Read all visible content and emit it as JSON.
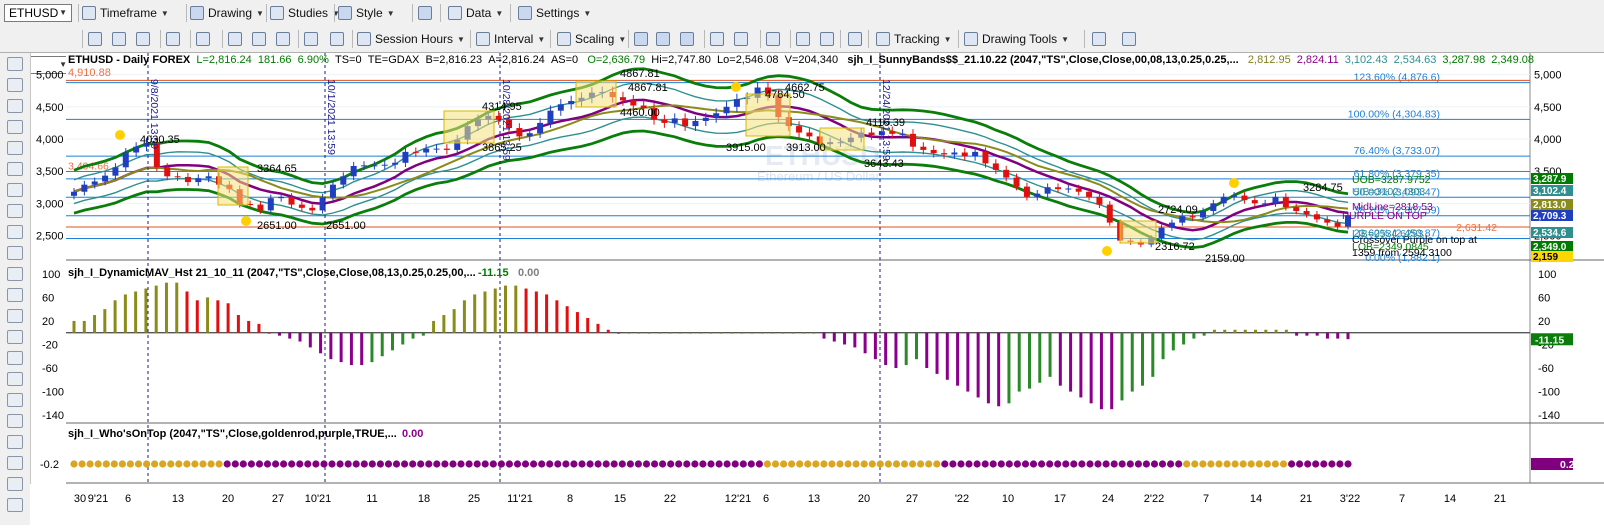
{
  "toolbar": {
    "symbol": "ETHUSD",
    "row1": [
      {
        "name": "timeframe-menu",
        "icon": "clock-icon",
        "label": "Timeframe"
      },
      {
        "name": "drawing-menu",
        "icon": "pencil-icon",
        "label": "Drawing"
      },
      {
        "name": "studies-menu",
        "icon": "studies-icon",
        "label": "Studies"
      },
      {
        "name": "style-menu",
        "icon": "style-icon",
        "label": "Style"
      },
      {
        "name": "data-menu",
        "icon": "data-icon",
        "label": "Data"
      },
      {
        "name": "settings-menu",
        "icon": "gear-icon",
        "label": "Settings"
      }
    ],
    "row2": [
      {
        "name": "session-hours-menu",
        "icon": "session-icon",
        "label": "Session Hours"
      },
      {
        "name": "interval-menu",
        "icon": "interval-icon",
        "label": "Interval"
      },
      {
        "name": "scaling-menu",
        "icon": "scaling-icon",
        "label": "Scaling"
      },
      {
        "name": "tracking-menu",
        "icon": "tracking-icon",
        "label": "Tracking"
      },
      {
        "name": "drawing-tools-menu",
        "icon": "drawing-tools-icon",
        "label": "Drawing Tools"
      }
    ]
  },
  "header": {
    "symbol_line": "ETHUSD - Daily  FOREX",
    "L": "L=2,816.24",
    "chg": "181.66",
    "pct": "6.90%",
    "ts": "TS=0",
    "te": "TE=GDAX",
    "B": "B=2,816.23",
    "A": "A=2,816.24",
    "AS": "AS=0",
    "O": "O=2,636.79",
    "Hi": "Hi=2,747.80",
    "Lo": "Lo=2,546.08",
    "V": "V=204,340",
    "study": "sjh_I_SunnyBands$$_21.10.22 (2047,\"TS\",Close,Close,00,08,13,0.25,0.25,...",
    "vals": [
      {
        "v": "2,812.95",
        "c": "#7f7f1f"
      },
      {
        "v": "2,824.11",
        "c": "#8b008b"
      },
      {
        "v": "3,102.43",
        "c": "#2f8f8f"
      },
      {
        "v": "2,534.63",
        "c": "#2f8f8f"
      },
      {
        "v": "3,287.98",
        "c": "#007a00"
      },
      {
        "v": "2,349.08",
        "c": "#007a00"
      }
    ],
    "top_left_orange": "4,910.88"
  },
  "watermark": {
    "title": "ETHUSD",
    "subtitle": "Ethereum / US Dollar"
  },
  "chart_data": [
    {
      "type": "candlestick",
      "title": "ETHUSD - Daily  FOREX",
      "ylim": [
        2150,
        5150
      ],
      "yticks": [
        2500,
        3000,
        3500,
        4000,
        4500,
        5000
      ],
      "ytick_labels": [
        "2,500",
        "3,000",
        "3,500",
        "4,000",
        "4,500",
        "5,000"
      ],
      "x_labels": [
        "30",
        "9'21",
        "6",
        "13",
        "20",
        "27",
        "10'21",
        "11",
        "18",
        "25",
        "11'21",
        "8",
        "15",
        "22",
        "12'21",
        "6",
        "13",
        "20",
        "27",
        "'22",
        "10",
        "17",
        "24",
        "2'22",
        "7",
        "14",
        "21",
        "3'22",
        "7",
        "14",
        "21"
      ],
      "close": [
        3180,
        3290,
        3340,
        3430,
        3560,
        3790,
        3880,
        3940,
        3560,
        3420,
        3410,
        3330,
        3390,
        3420,
        3290,
        3220,
        2990,
        2980,
        2890,
        3080,
        3100,
        2980,
        2930,
        2890,
        3090,
        3290,
        3420,
        3580,
        3590,
        3590,
        3600,
        3630,
        3800,
        3790,
        3850,
        3850,
        3830,
        3990,
        4200,
        4300,
        4360,
        4300,
        4170,
        4040,
        4090,
        4250,
        4440,
        4540,
        4590,
        4640,
        4720,
        4730,
        4650,
        4600,
        4520,
        4480,
        4300,
        4250,
        4320,
        4200,
        4280,
        4330,
        4400,
        4500,
        4620,
        4640,
        4800,
        4680,
        4340,
        4200,
        4100,
        4040,
        3920,
        3950,
        3950,
        4020,
        4100,
        4060,
        4120,
        4080,
        4080,
        3880,
        3830,
        3780,
        3760,
        3790,
        3730,
        3800,
        3620,
        3520,
        3400,
        3260,
        3100,
        3150,
        3250,
        3220,
        3230,
        3180,
        3100,
        2980,
        2700,
        2420,
        2400,
        2360,
        2460,
        2620,
        2700,
        2800,
        2780,
        2880,
        3000,
        3100,
        3120,
        3050,
        3000,
        3000,
        3100,
        2940,
        2880,
        2830,
        2750,
        2700,
        2640,
        2816
      ],
      "horizontal_levels": [
        {
          "label": "123.60% (4,876.6)",
          "value": 4876.6,
          "color": "#1e7fd6"
        },
        {
          "label": "100.00% (4,304.83)",
          "value": 4304.83,
          "color": "#1e7fd6"
        },
        {
          "label": "76.40% (3,733.07)",
          "value": 3733.07,
          "color": "#1e7fd6"
        },
        {
          "label": "61.80% (3,379.35)",
          "value": 3379.35,
          "color": "#1e7fd6"
        },
        {
          "label": "50.00% (3,093.47)",
          "value": 3093.47,
          "color": "#1e7fd6"
        },
        {
          "label": "38.20% (2,807.59)",
          "value": 2807.59,
          "color": "#1e7fd6"
        },
        {
          "label": "23.60% (2,453.87)",
          "value": 2453.87,
          "color": "#1e7fd6"
        },
        {
          "label": "0.00% (1,882.1)",
          "value": 1882.1,
          "color": "#1e7fd6"
        }
      ],
      "orange_levels": [
        {
          "label": "4,910.88",
          "value": 4910.88
        },
        {
          "label": "3,494.66",
          "value": 3494.66
        },
        {
          "label": "2,631.42",
          "value": 2631.42
        }
      ],
      "annotations": [
        "4867.81",
        "4867.81",
        "4784.50",
        "4662.75",
        "4460.00",
        "4314.95",
        "4030.35",
        "3915.00",
        "3913.00",
        "4116.39",
        "3865.25",
        "3643.43",
        "3364.65",
        "3284.75",
        "2724.09",
        "2651.00",
        "2651.00",
        "2316.72",
        "2159.00",
        "PURPLE ON TOP",
        "Crossover Purple on top at",
        "1359 from 2594.3100"
      ],
      "band_labels": [
        {
          "label": "UOB=3287.9752",
          "color": "#007a00"
        },
        {
          "label": "UIB=3102.4303",
          "color": "#2f8f8f"
        },
        {
          "label": "MidLine=2818.53",
          "color": "#8b008b"
        },
        {
          "label": "LIB=2534.6293",
          "color": "#2f8f8f"
        },
        {
          "label": "LOB=2349.0845",
          "color": "#007a00"
        }
      ],
      "price_tags": [
        {
          "v": "3,287.9",
          "bg": "#007a00",
          "fg": "#ffffff"
        },
        {
          "v": "3,102.4",
          "bg": "#2f8f8f",
          "fg": "#ffffff"
        },
        {
          "v": "2,813.0",
          "bg": "#8b8b1a",
          "fg": "#ffffff"
        },
        {
          "v": "2,709.3",
          "bg": "#1f3fbf",
          "fg": "#ffffff"
        },
        {
          "v": "2,534.6",
          "bg": "#2f8f8f",
          "fg": "#ffffff"
        },
        {
          "v": "2,349.0",
          "bg": "#007a00",
          "fg": "#ffffff"
        },
        {
          "v": "2,159",
          "bg": "#ffd700",
          "fg": "#000000"
        }
      ],
      "vertical_date_labels": [
        "9/8/2021 13:59",
        "10/1/2021 13:59",
        "10/28/2021 13:59",
        "12/24/2021 13:59"
      ]
    },
    {
      "type": "bar",
      "title": "sjh_I_DynamicMAV_Hst 21_10_11 (2047,\"TS\",Close,Close,08,13,0.25,0.25,00,...",
      "value_label": "-11.15",
      "value_label2": "0.00",
      "ylim": [
        -150,
        115
      ],
      "yticks": [
        100,
        60,
        20,
        -20,
        -60,
        -100,
        -140
      ],
      "ytick_labels": [
        "100",
        "60",
        "20",
        "-20",
        "-60",
        "-100",
        "-140"
      ],
      "values": [
        20,
        20,
        30,
        40,
        55,
        65,
        70,
        75,
        80,
        85,
        85,
        70,
        55,
        60,
        55,
        50,
        30,
        20,
        15,
        0,
        -5,
        -10,
        -15,
        -25,
        -35,
        -45,
        -50,
        -55,
        -55,
        -50,
        -40,
        -30,
        -20,
        -10,
        -5,
        20,
        30,
        40,
        55,
        65,
        70,
        75,
        80,
        80,
        75,
        70,
        65,
        55,
        45,
        35,
        25,
        15,
        5,
        0,
        0,
        0,
        0,
        0,
        0,
        0,
        0,
        0,
        0,
        0,
        0,
        0,
        0,
        0,
        0,
        0,
        0,
        0,
        0,
        -10,
        -15,
        -20,
        -25,
        -35,
        -45,
        -55,
        -60,
        -55,
        -45,
        -60,
        -70,
        -80,
        -90,
        -100,
        -110,
        -120,
        -125,
        -120,
        -100,
        -95,
        -85,
        -75,
        -90,
        -100,
        -110,
        -120,
        -130,
        -130,
        -115,
        -100,
        -90,
        -75,
        -45,
        -30,
        -20,
        -10,
        -5,
        5,
        5,
        5,
        5,
        5,
        5,
        5,
        5,
        -5,
        -5,
        -5,
        -10,
        -10,
        -11
      ],
      "colors_rule": "positive: olive rising / red falling; negative: purple falling / green rising",
      "last_value_tag": "-11.15"
    },
    {
      "type": "dots",
      "title": "sjh_I_Who'sOnTop (2047,\"TS\",Close,goldenrod,purple,TRUE,...",
      "value_label": "0.00",
      "ylim": [
        -0.35,
        0.1
      ],
      "yticks": [
        -0.2
      ],
      "ytick_labels": [
        "-0.2"
      ],
      "colors": [
        "goldenrod",
        "purple"
      ],
      "segments": [
        {
          "count": 19,
          "color": "goldenrod"
        },
        {
          "count": 67,
          "color": "purple"
        },
        {
          "count": 22,
          "color": "goldenrod"
        },
        {
          "count": 30,
          "color": "purple"
        },
        {
          "count": 13,
          "color": "goldenrod"
        },
        {
          "count": 8,
          "color": "purple"
        }
      ],
      "last_value_tag": "0.2"
    }
  ]
}
